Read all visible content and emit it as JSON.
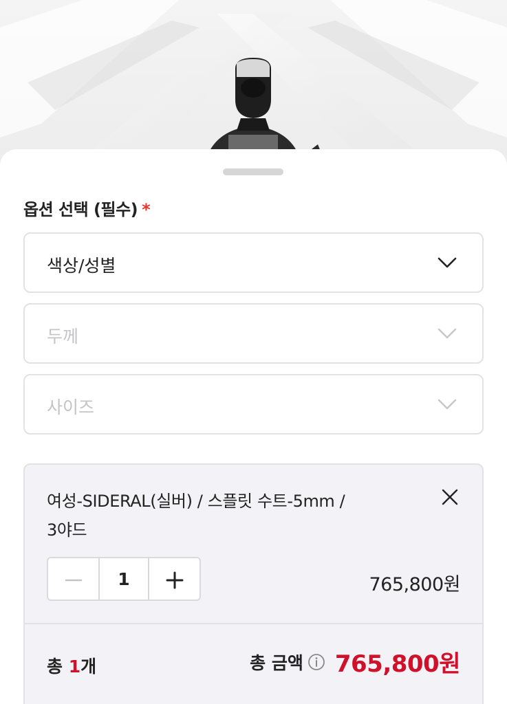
{
  "options": {
    "title": "옵션 선택 (필수)",
    "required_mark": "*",
    "selects": [
      {
        "label": "색상/성별",
        "enabled": true
      },
      {
        "label": "두께",
        "enabled": false
      },
      {
        "label": "사이즈",
        "enabled": false
      }
    ]
  },
  "selected_item": {
    "name_line1": "여성-SIDERAL(실버) / 스플릿 수트-5mm /",
    "name_line2": "3야드",
    "quantity": "1",
    "price": "765,800원"
  },
  "summary": {
    "count_prefix": "총 ",
    "count_value": "1",
    "count_suffix": "개",
    "amount_label": "총 금액",
    "amount": "765,800원"
  },
  "colors": {
    "accent": "#d0112b",
    "required": "#e8352a",
    "border": "#e2e2e6",
    "item_bg": "#f3f3f7"
  },
  "icons": [
    "chevron-down-icon",
    "close-icon",
    "minus-icon",
    "plus-icon",
    "info-icon"
  ]
}
